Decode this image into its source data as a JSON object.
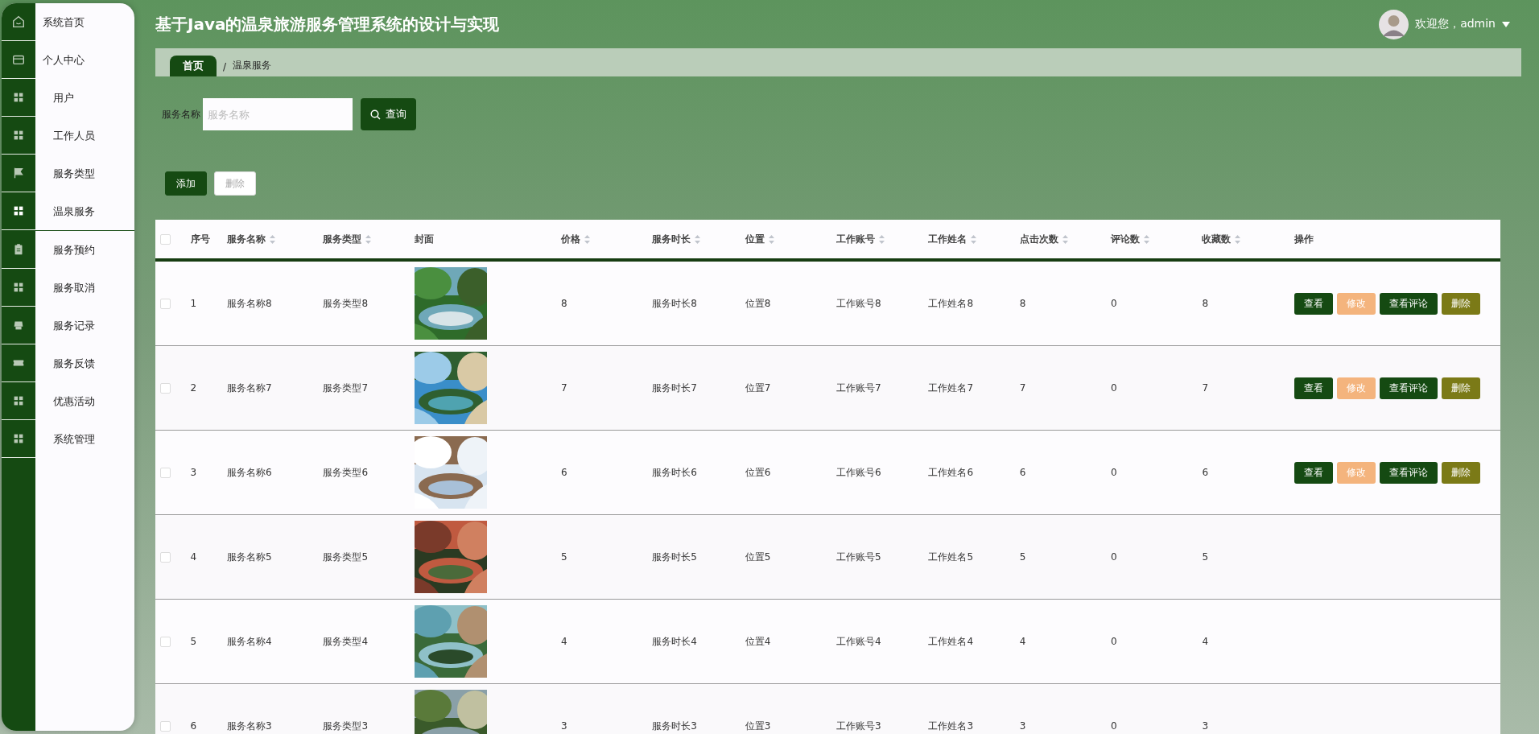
{
  "sidebar": {
    "items": [
      {
        "label": "系统首页",
        "kind": "top",
        "selected": false
      },
      {
        "label": "个人中心",
        "kind": "top",
        "selected": false
      },
      {
        "label": "用户",
        "kind": "sub",
        "selected": false
      },
      {
        "label": "工作人员",
        "kind": "sub",
        "selected": false
      },
      {
        "label": "服务类型",
        "kind": "sub",
        "selected": false
      },
      {
        "label": "温泉服务",
        "kind": "sub",
        "selected": true
      },
      {
        "label": "服务预约",
        "kind": "sub",
        "selected": false
      },
      {
        "label": "服务取消",
        "kind": "sub",
        "selected": false
      },
      {
        "label": "服务记录",
        "kind": "sub",
        "selected": false
      },
      {
        "label": "服务反馈",
        "kind": "sub",
        "selected": false
      },
      {
        "label": "优惠活动",
        "kind": "sub",
        "selected": false
      },
      {
        "label": "系统管理",
        "kind": "sub",
        "selected": false
      }
    ]
  },
  "header": {
    "title": "基于Java的温泉旅游服务管理系统的设计与实现",
    "user": "欢迎您，admin"
  },
  "breadcrumb": {
    "home": "首页",
    "separator": "/",
    "current": "温泉服务"
  },
  "search": {
    "label": "服务名称",
    "placeholder": "服务名称",
    "button": "查询"
  },
  "toolbar": [
    {
      "label": "添加",
      "disabled": false
    },
    {
      "label": "删除",
      "disabled": true
    }
  ],
  "table": {
    "header_checked": false,
    "columns": [
      {
        "label": "序号",
        "sortable": false
      },
      {
        "label": "服务名称",
        "sortable": true
      },
      {
        "label": "服务类型",
        "sortable": true
      },
      {
        "label": "封面",
        "sortable": false
      },
      {
        "label": "价格",
        "sortable": true
      },
      {
        "label": "服务时长",
        "sortable": true
      },
      {
        "label": "位置",
        "sortable": true
      },
      {
        "label": "工作账号",
        "sortable": true
      },
      {
        "label": "工作姓名",
        "sortable": true
      },
      {
        "label": "点击次数",
        "sortable": true
      },
      {
        "label": "评论数",
        "sortable": true
      },
      {
        "label": "收藏数",
        "sortable": true
      },
      {
        "label": "操作",
        "sortable": false
      }
    ],
    "rows": [
      {
        "checked": false,
        "cells": [
          "1",
          "服务名称8",
          "服务类型8",
          {
            "kind": "picture"
          },
          "8",
          "服务时长8",
          "位置8",
          "工作账号8",
          "工作姓名8",
          "8",
          "0",
          "8"
        ],
        "actions": [
          {
            "label": "查看",
            "kind": "view"
          },
          {
            "label": "修改",
            "kind": "edit"
          },
          {
            "label": "查看评论",
            "kind": "view"
          },
          {
            "label": "删除",
            "kind": "delete"
          }
        ]
      },
      {
        "checked": false,
        "cells": [
          "2",
          "服务名称7",
          "服务类型7",
          {
            "kind": "picture"
          },
          "7",
          "服务时长7",
          "位置7",
          "工作账号7",
          "工作姓名7",
          "7",
          "0",
          "7"
        ],
        "actions": [
          {
            "label": "查看",
            "kind": "view"
          },
          {
            "label": "修改",
            "kind": "edit"
          },
          {
            "label": "查看评论",
            "kind": "view"
          },
          {
            "label": "删除",
            "kind": "delete"
          }
        ]
      },
      {
        "checked": false,
        "cells": [
          "3",
          "服务名称6",
          "服务类型6",
          {
            "kind": "picture"
          },
          "6",
          "服务时长6",
          "位置6",
          "工作账号6",
          "工作姓名6",
          "6",
          "0",
          "6"
        ],
        "actions": [
          {
            "label": "查看",
            "kind": "view"
          },
          {
            "label": "修改",
            "kind": "edit"
          },
          {
            "label": "查看评论",
            "kind": "view"
          },
          {
            "label": "删除",
            "kind": "delete"
          }
        ]
      },
      {
        "checked": false,
        "cells": [
          "4",
          "服务名称5",
          "服务类型5",
          {
            "kind": "picture"
          },
          "5",
          "服务时长5",
          "位置5",
          "工作账号5",
          "工作姓名5",
          "5",
          "0",
          "5"
        ]
      },
      {
        "checked": false,
        "cells": [
          "5",
          "服务名称4",
          "服务类型4",
          {
            "kind": "picture"
          },
          "4",
          "服务时长4",
          "位置4",
          "工作账号4",
          "工作姓名4",
          "4",
          "0",
          "4"
        ]
      },
      {
        "checked": false,
        "cells": [
          "6",
          "服务名称3",
          "服务类型3",
          {
            "kind": "picture"
          },
          "3",
          "服务时长3",
          "位置3",
          "工作账号3",
          "工作姓名3",
          "3",
          "0",
          "3"
        ]
      }
    ]
  }
}
